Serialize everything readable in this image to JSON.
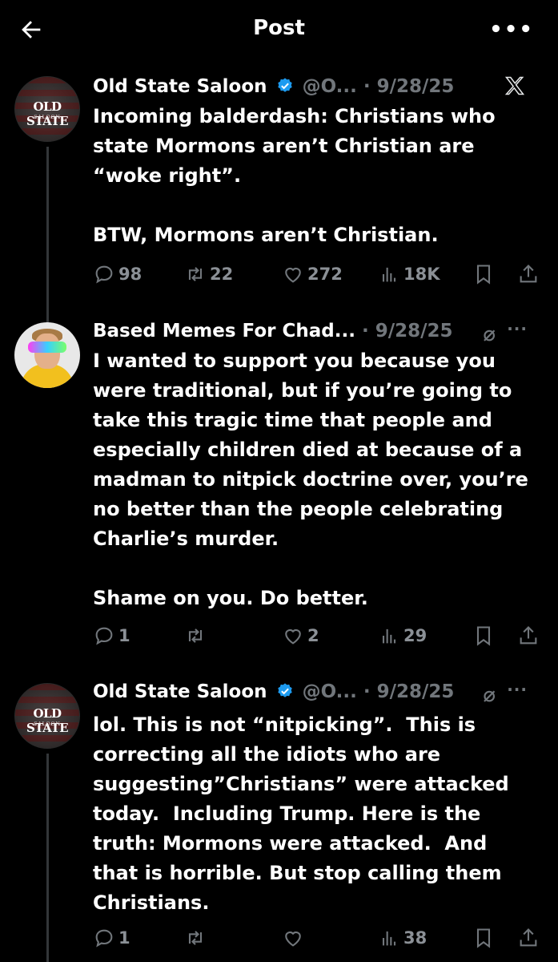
{
  "header": {
    "title": "Post",
    "more_label": "•••"
  },
  "tweets": [
    {
      "display_name": "Old State Saloon",
      "verified": true,
      "handle_date": "@O... · 9/28/25",
      "avatar_text": "OLD STATE",
      "avatar_subtext": "SALOON",
      "body": "Incoming balderdash: Christians who state Mormons aren’t Christian are “woke right”.\n\nBTW, Mormons aren’t Christian.",
      "replies": "98",
      "reposts": "22",
      "likes": "272",
      "views": "18K"
    },
    {
      "display_name": "Based Memes For Chad...",
      "handle_date": " · 9/28/25",
      "body": "I wanted to support you because you were traditional, but if you’re going to take this tragic time that people and especially children died at because of a madman to nitpick doctrine over, you’re no better than the people celebrating Charlie’s murder.\n\nShame on you. Do better.",
      "replies": "1",
      "reposts": "",
      "likes": "2",
      "views": "29"
    },
    {
      "display_name": "Old State Saloon",
      "verified": true,
      "handle_date": "@O... · 9/28/25",
      "avatar_text": "OLD STATE",
      "avatar_subtext": "SALOON",
      "body": "lol. This is not “nitpicking”.  This is correcting all the idiots who are suggesting”Christians” were attacked today.  Including Trump. Here is the truth: Mormons were attacked.  And that is horrible. But stop calling them Christians.",
      "replies": "1",
      "reposts": "",
      "likes": "",
      "views": "38"
    }
  ],
  "colors": {
    "background": "#000000",
    "text": "#e7e9ea",
    "muted": "#71767b",
    "verified": "#1d9bf0"
  },
  "icons": [
    "back-arrow-icon",
    "more-icon",
    "verified-icon",
    "x-logo-icon",
    "grok-icon",
    "reply-icon",
    "repost-icon",
    "like-icon",
    "views-icon",
    "bookmark-icon",
    "share-icon"
  ]
}
